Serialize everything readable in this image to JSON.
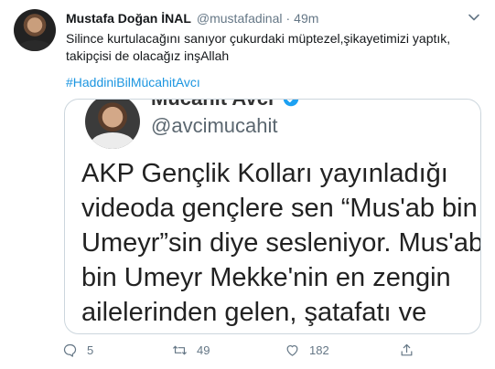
{
  "tweet": {
    "display_name": "Mustafa Doğan İNAL",
    "handle": "@mustafadinal",
    "separator": "·",
    "time": "49m",
    "text_line1": "Silince kurtulacağını sanıyor çukurdaki müptezel,şikayetimizi yaptık,",
    "text_line2": "takipçisi de olacağız inşAllah",
    "hashtag": "#HaddiniBilMücahitAvcı"
  },
  "embedded": {
    "display_name": "Mücahit Avcı",
    "handle": "@avcimucahit",
    "lines": [
      "AKP Gençlik Kolları yayınladığı",
      "videoda gençlere sen “Mus'ab bin",
      "Umeyr”sin diye sesleniyor. Mus'ab",
      "bin Umeyr Mekke'nin en zengin",
      "ailelerinden gelen, şatafatı ve"
    ]
  },
  "actions": {
    "reply_count": "5",
    "retweet_count": "49",
    "like_count": "182"
  },
  "colors": {
    "link": "#1b95e0",
    "muted": "#657786",
    "verified": "#1da1f2"
  }
}
